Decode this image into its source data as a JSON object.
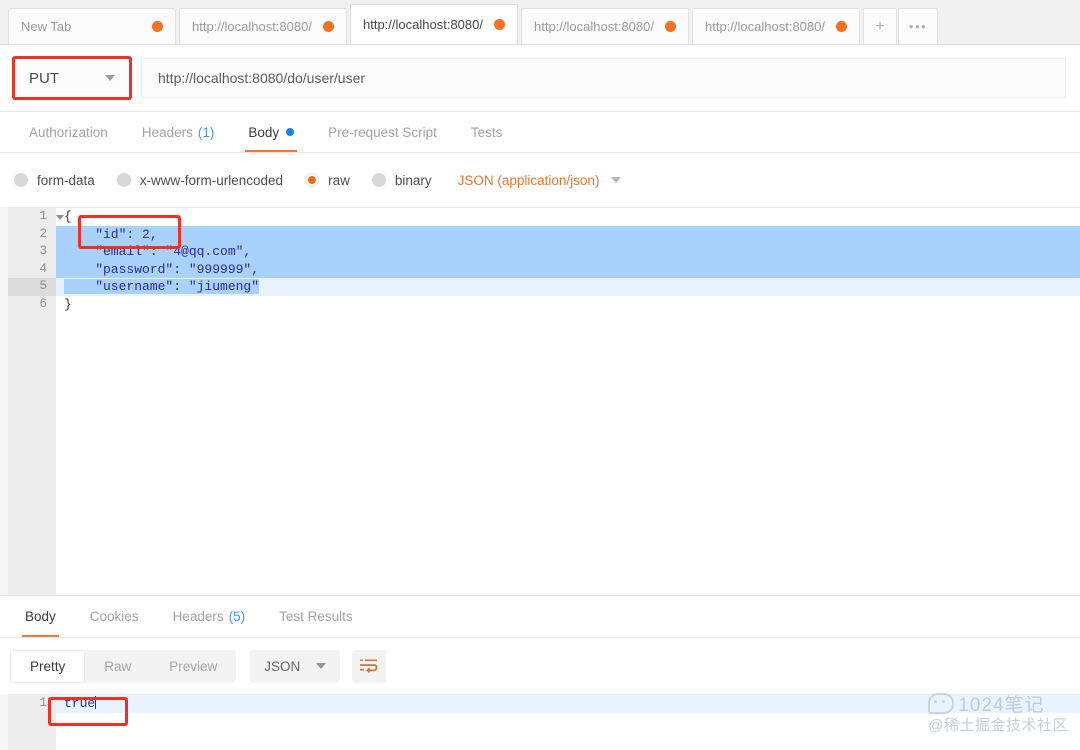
{
  "tabbar": {
    "tabs": [
      {
        "label": "New Tab",
        "active": false,
        "dot": true
      },
      {
        "label": "http://localhost:8080/",
        "active": false,
        "dot": true
      },
      {
        "label": "http://localhost:8080/",
        "active": true,
        "dot": true
      },
      {
        "label": "http://localhost:8080/",
        "active": false,
        "dot": true
      },
      {
        "label": "http://localhost:8080/",
        "active": false,
        "dot": true
      }
    ],
    "new_tab_label": "+",
    "more_label": "•••"
  },
  "request": {
    "method": "PUT",
    "url": "http://localhost:8080/do/user/user",
    "tabs": [
      {
        "label": "Authorization",
        "active": false
      },
      {
        "label": "Headers",
        "count": "(1)",
        "active": false
      },
      {
        "label": "Body",
        "active": true,
        "dot": true
      },
      {
        "label": "Pre-request Script",
        "active": false
      },
      {
        "label": "Tests",
        "active": false
      }
    ],
    "body_types": [
      {
        "label": "form-data",
        "selected": false
      },
      {
        "label": "x-www-form-urlencoded",
        "selected": false
      },
      {
        "label": "raw",
        "selected": true
      },
      {
        "label": "binary",
        "selected": false
      }
    ],
    "format": "JSON (application/json)",
    "body_lines": [
      {
        "num": "1",
        "text": "{",
        "folded": true,
        "selected": false,
        "active": false
      },
      {
        "num": "2",
        "text": "    \"id\": 2,",
        "selected": true,
        "active": false
      },
      {
        "num": "3",
        "text": "    \"email\": \"4@qq.com\",",
        "selected": true,
        "active": false
      },
      {
        "num": "4",
        "text": "    \"password\": \"999999\",",
        "selected": true,
        "active": false
      },
      {
        "num": "5",
        "text": "    \"username\": \"jiumeng\"",
        "selected": false,
        "active": true
      },
      {
        "num": "6",
        "text": "}",
        "selected": false,
        "active": false
      }
    ]
  },
  "response": {
    "tabs": [
      {
        "label": "Body",
        "active": true
      },
      {
        "label": "Cookies",
        "active": false
      },
      {
        "label": "Headers",
        "count": "(5)",
        "active": false
      },
      {
        "label": "Test Results",
        "active": false
      }
    ],
    "view_modes": [
      {
        "label": "Pretty",
        "active": true
      },
      {
        "label": "Raw",
        "active": false
      },
      {
        "label": "Preview",
        "active": false
      }
    ],
    "format": "JSON",
    "wrap_icon": "wrap-lines-icon",
    "body_lines": [
      {
        "num": "1",
        "text": "true"
      }
    ]
  },
  "annotations": {
    "method_box": "highlight-method-selector",
    "id_box": "highlight-id-field",
    "true_box": "highlight-response-true"
  },
  "watermark": {
    "line1": "1024笔记",
    "line2": "@稀土掘金技术社区"
  },
  "colors": {
    "accent_orange": "#ef7c34",
    "annotation_red": "#ee3124",
    "selection_blue": "#a8d1fb",
    "dot_blue": "#1e7fe0",
    "tab_dot_orange": "#f47023"
  }
}
